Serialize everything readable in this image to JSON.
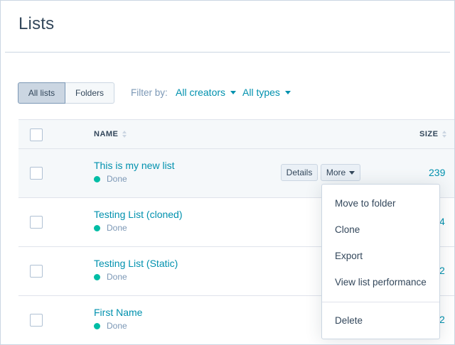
{
  "page": {
    "title": "Lists"
  },
  "view_toggle": {
    "all_lists": "All lists",
    "folders": "Folders"
  },
  "filters": {
    "label": "Filter by:",
    "creators": "All creators",
    "types": "All types"
  },
  "table": {
    "columns": {
      "name": "NAME",
      "size": "SIZE"
    },
    "rows": [
      {
        "name": "This is my new list",
        "status": "Done",
        "size": "239"
      },
      {
        "name": "Testing List (cloned)",
        "status": "Done",
        "size": "4"
      },
      {
        "name": "Testing List (Static)",
        "status": "Done",
        "size": "2"
      },
      {
        "name": "First Name",
        "status": "Done",
        "size": "2"
      }
    ],
    "row_actions": {
      "details": "Details",
      "more": "More"
    }
  },
  "more_menu": {
    "items": [
      "Move to folder",
      "Clone",
      "Export",
      "View list performance",
      "Delete"
    ]
  },
  "colors": {
    "link": "#0091ae",
    "text": "#33475b",
    "status_done": "#00bda5"
  }
}
